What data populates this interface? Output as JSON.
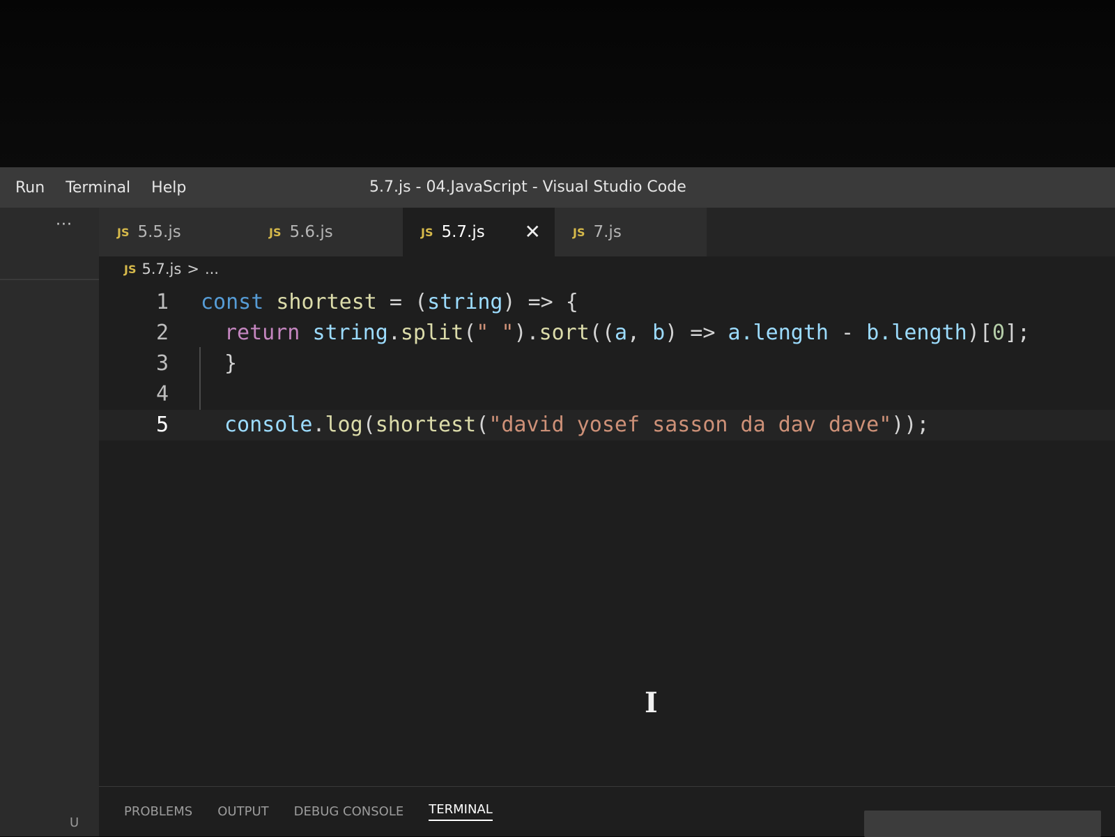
{
  "menu": {
    "items": [
      "Run",
      "Terminal",
      "Help"
    ]
  },
  "window_title": "5.7.js - 04.JavaScript - Visual Studio Code",
  "tabs": [
    {
      "label": "5.5.js",
      "icon": "JS"
    },
    {
      "label": "5.6.js",
      "icon": "JS"
    },
    {
      "label": "5.7.js",
      "icon": "JS"
    },
    {
      "label": "7.js",
      "icon": "JS"
    }
  ],
  "more_actions": "···",
  "close_glyph": "✕",
  "breadcrumb": {
    "icon": "JS",
    "file": "5.7.js",
    "separator": ">",
    "rest": "..."
  },
  "code": {
    "line_numbers": [
      "1",
      "2",
      "3",
      "4",
      "5"
    ],
    "tokens": {
      "const": "const",
      "shortest": "shortest",
      "eq": " = ",
      "paren_open": "(",
      "string": "string",
      "arrow_brace": ") => {",
      "return": "return",
      "split": "split",
      "split_open": "(",
      "space_str": "\" \"",
      "split_close": ").",
      "sort": "sort",
      "sort_args_a": "((",
      "a": "a",
      "comma": ", ",
      "b": "b",
      "sort_arrow": ") => ",
      "dot_length": ".length",
      "minus": " - ",
      "idx_open": ")[",
      "zero": "0",
      "idx_close": "];",
      "close_brace": "}",
      "console": "console",
      "log": "log",
      "log_open": "(",
      "call_open": "(",
      "arg_str": "\"david yosef sasson da dav dave\"",
      "end": "));",
      "dot": "."
    }
  },
  "panel": {
    "tabs": [
      "PROBLEMS",
      "OUTPUT",
      "DEBUG CONSOLE",
      "TERMINAL"
    ]
  },
  "status": {
    "left": "U"
  },
  "cursor_glyph": "I"
}
